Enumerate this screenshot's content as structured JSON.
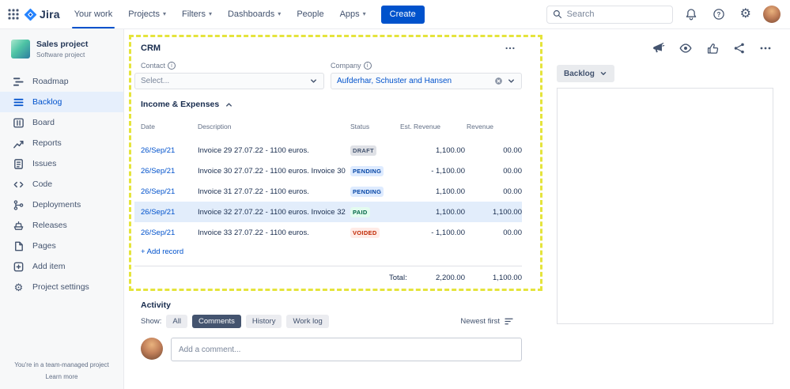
{
  "colors": {
    "accent": "#0052CC",
    "capture_border": "#E5E43C",
    "highlight_row_bg": "#E2EDFB",
    "status_draft_bg": "#DFE1E6",
    "status_pending_bg": "#DEEBFF",
    "status_paid_bg": "#E3FCEF",
    "status_voided_bg": "#FFEBE6"
  },
  "topnav": {
    "logo_text": "Jira",
    "items": [
      {
        "label": "Your work",
        "active": true
      },
      {
        "label": "Projects",
        "chevron": "chevron-down-icon"
      },
      {
        "label": "Filters",
        "chevron": "chevron-down-icon"
      },
      {
        "label": "Dashboards",
        "chevron": "chevron-down-icon"
      },
      {
        "label": "People"
      },
      {
        "label": "Apps",
        "chevron": "chevron-down-icon"
      }
    ],
    "create_label": "Create",
    "search_placeholder": "Search",
    "right_icons": [
      "bell-icon",
      "help-icon",
      "gear-icon",
      "user-avatar"
    ]
  },
  "sidebar": {
    "project_name": "Sales project",
    "project_type": "Software project",
    "items": [
      {
        "label": "Roadmap",
        "icon": "roadmap-icon"
      },
      {
        "label": "Backlog",
        "icon": "backlog-icon",
        "active": true
      },
      {
        "label": "Board",
        "icon": "board-icon"
      },
      {
        "label": "Reports",
        "icon": "reports-icon"
      },
      {
        "label": "Issues",
        "icon": "issues-icon"
      },
      {
        "label": "Code",
        "icon": "code-icon"
      },
      {
        "label": "Deployments",
        "icon": "deployments-icon"
      },
      {
        "label": "Releases",
        "icon": "releases-icon"
      },
      {
        "label": "Pages",
        "icon": "pages-icon"
      },
      {
        "label": "Add item",
        "icon": "add-item-icon"
      },
      {
        "label": "Project settings",
        "icon": "settings-icon"
      }
    ],
    "footer_text": "You're in a team-managed project",
    "footer_link": "Learn more"
  },
  "main": {
    "title": "CRM",
    "fields": {
      "contact_label": "Contact",
      "contact_placeholder": "Select...",
      "company_label": "Company",
      "company_value": "Aufderhar, Schuster and Hansen"
    },
    "section_title": "Income & Expenses",
    "table": {
      "headers": [
        "Date",
        "Description",
        "Status",
        "Est. Revenue",
        "Revenue"
      ],
      "rows": [
        {
          "date": "26/Sep/21",
          "description": "Invoice 29 27.07.22 - 1100 euros.",
          "status": "DRAFT",
          "est_revenue": "1,100.00",
          "revenue": "00.00",
          "highlighted": false
        },
        {
          "date": "26/Sep/21",
          "description": "Invoice 30 27.07.22 - 1100 euros. Invoice 30",
          "status": "PENDING",
          "est_revenue": "- 1,100.00",
          "revenue": "00.00",
          "highlighted": false
        },
        {
          "date": "26/Sep/21",
          "description": "Invoice 31 27.07.22 - 1100 euros.",
          "status": "PENDING",
          "est_revenue": "1,100.00",
          "revenue": "00.00",
          "highlighted": false
        },
        {
          "date": "26/Sep/21",
          "description": "Invoice 32 27.07.22 - 1100 euros. Invoice 32",
          "status": "PAID",
          "est_revenue": "1,100.00",
          "revenue": "1,100.00",
          "highlighted": true
        },
        {
          "date": "26/Sep/21",
          "description": "Invoice 33 27.07.22 - 1100 euros.",
          "status": "VOIDED",
          "est_revenue": "- 1,100.00",
          "revenue": "00.00",
          "highlighted": false
        }
      ],
      "add_record_label": "+ Add record",
      "total_label": "Total:",
      "total_est_revenue": "2,200.00",
      "total_revenue": "1,100.00"
    },
    "activity": {
      "title": "Activity",
      "show_label": "Show:",
      "filters": [
        {
          "label": "All",
          "active": false
        },
        {
          "label": "Comments",
          "active": true
        },
        {
          "label": "History",
          "active": false
        },
        {
          "label": "Work log",
          "active": false
        }
      ],
      "sort_label": "Newest first",
      "comment_placeholder": "Add a comment..."
    }
  },
  "detail_panel": {
    "icons": [
      "feedback-megaphone-icon",
      "watch-eye-icon",
      "like-thumb-icon",
      "share-icon",
      "more-icon"
    ],
    "status_button_label": "Backlog"
  }
}
